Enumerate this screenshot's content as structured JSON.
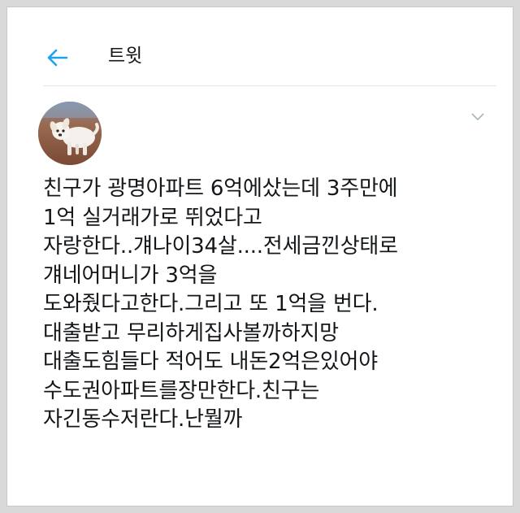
{
  "header": {
    "title": "트윗"
  },
  "tweet": {
    "lines": [
      "친구가 광명아파트 6억에샀는데 3주만에",
      "1억 실거래가로 뛰었다고",
      "자랑한다..걔나이34살....전세금낀상태로",
      "걔네어머니가 3억을",
      "도와줬다고한다.그리고 또 1억을 번다.",
      "대출받고 무리하게집사볼까하지망",
      "대출도힘들다 적어도 내돈2억은있어야",
      "수도권아파트를장만한다.친구는",
      "자긴동수저란다.난뭘까"
    ]
  },
  "icons": {
    "back": "arrow-left-icon",
    "more": "chevron-down-icon",
    "avatar": "puppy-photo"
  },
  "colors": {
    "accent": "#1da1f2",
    "text": "#14171a",
    "muted": "#aab8c2",
    "divider": "#e1e8ed"
  }
}
